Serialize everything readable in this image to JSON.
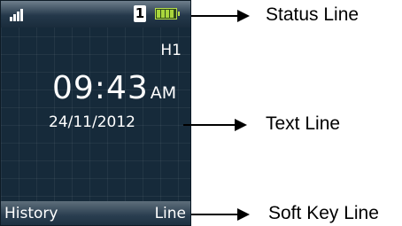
{
  "phone": {
    "status": {
      "line_number": "1",
      "icons": [
        "signal-icon",
        "line-badge",
        "battery-icon"
      ]
    },
    "handset_name": "H1",
    "time": "09:43",
    "am_pm": "AM",
    "date": "24/11/2012",
    "softkeys": {
      "left": "History",
      "right": "Line"
    }
  },
  "annotations": {
    "status_line": "Status Line",
    "text_line": "Text Line",
    "soft_key_line": "Soft Key Line"
  },
  "colors": {
    "screen_bg": "#162a3a",
    "bar_bg": "#24384a",
    "battery": "#a9d63c",
    "text": "#ffffff",
    "annotation": "#000000"
  }
}
